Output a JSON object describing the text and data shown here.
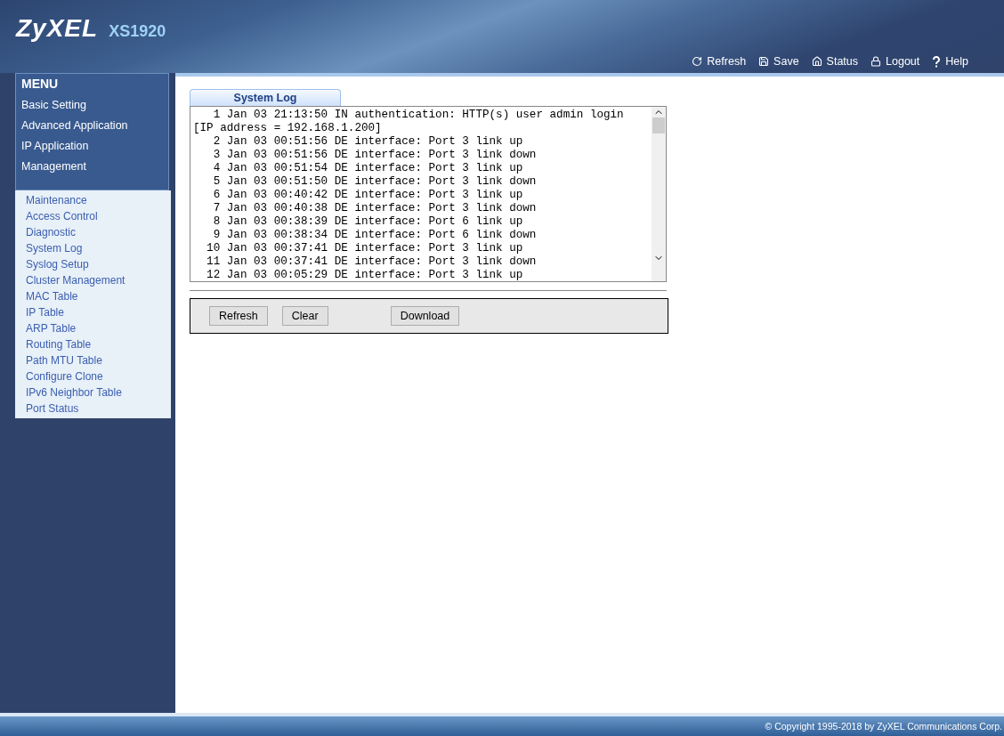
{
  "header": {
    "brand": "ZyXEL",
    "model": "XS1920"
  },
  "toolbar": [
    {
      "kind": "refresh",
      "label": "Refresh"
    },
    {
      "kind": "save",
      "label": "Save"
    },
    {
      "kind": "status",
      "label": "Status"
    },
    {
      "kind": "logout",
      "label": "Logout"
    },
    {
      "kind": "help",
      "label": "Help"
    }
  ],
  "menu": {
    "title": "MENU",
    "sections": [
      "Basic Setting",
      "Advanced Application",
      "IP Application",
      "Management"
    ],
    "items": [
      "Maintenance",
      "Access Control",
      "Diagnostic",
      "System Log",
      "Syslog Setup",
      "Cluster Management",
      "MAC Table",
      "IP Table",
      "ARP Table",
      "Routing Table",
      "Path MTU Table",
      "Configure Clone",
      "IPv6 Neighbor Table",
      "Port Status"
    ]
  },
  "panel": {
    "tab": "System Log",
    "log_lines": [
      "   1 Jan 03 21:13:50 IN authentication: HTTP(s) user admin login",
      "[IP address = 192.168.1.200]",
      "   2 Jan 03 00:51:56 DE interface: Port 3 link up",
      "   3 Jan 03 00:51:56 DE interface: Port 3 link down",
      "   4 Jan 03 00:51:54 DE interface: Port 3 link up",
      "   5 Jan 03 00:51:50 DE interface: Port 3 link down",
      "   6 Jan 03 00:40:42 DE interface: Port 3 link up",
      "   7 Jan 03 00:40:38 DE interface: Port 3 link down",
      "   8 Jan 03 00:38:39 DE interface: Port 6 link up",
      "   9 Jan 03 00:38:34 DE interface: Port 6 link down",
      "  10 Jan 03 00:37:41 DE interface: Port 3 link up",
      "  11 Jan 03 00:37:41 DE interface: Port 3 link down",
      "  12 Jan 03 00:05:29 DE interface: Port 3 link up"
    ],
    "buttons": [
      "Refresh",
      "Clear",
      "Download"
    ]
  },
  "footer": "© Copyright 1995-2018 by ZyXEL Communications Corp."
}
